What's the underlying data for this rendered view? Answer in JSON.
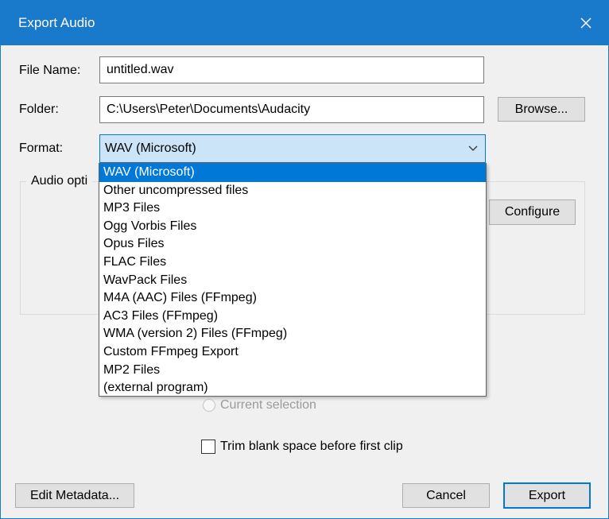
{
  "window": {
    "title": "Export Audio"
  },
  "file_name": {
    "label": "File Name:",
    "value": "untitled.wav"
  },
  "folder": {
    "label": "Folder:",
    "value": "C:\\Users\\Peter\\Documents\\Audacity",
    "browse_label": "Browse..."
  },
  "format": {
    "label": "Format:",
    "selected": "WAV (Microsoft)",
    "options": [
      "WAV (Microsoft)",
      "Other uncompressed files",
      "MP3 Files",
      "Ogg Vorbis Files",
      "Opus Files",
      "FLAC Files",
      "WavPack Files",
      "M4A (AAC) Files (FFmpeg)",
      "AC3 Files (FFmpeg)",
      "WMA (version 2) Files (FFmpeg)",
      "Custom FFmpeg Export",
      "MP2 Files",
      "(external program)"
    ]
  },
  "audio_options": {
    "label": "Audio opti",
    "configure_label": "Configure"
  },
  "export_range": {
    "current_selection_label": "Current selection"
  },
  "trim": {
    "label": "Trim blank space before first clip",
    "checked": false
  },
  "footer": {
    "edit_metadata_label": "Edit Metadata...",
    "cancel_label": "Cancel",
    "export_label": "Export"
  },
  "colors": {
    "accent": "#1979ca",
    "selection": "#0078d7"
  }
}
